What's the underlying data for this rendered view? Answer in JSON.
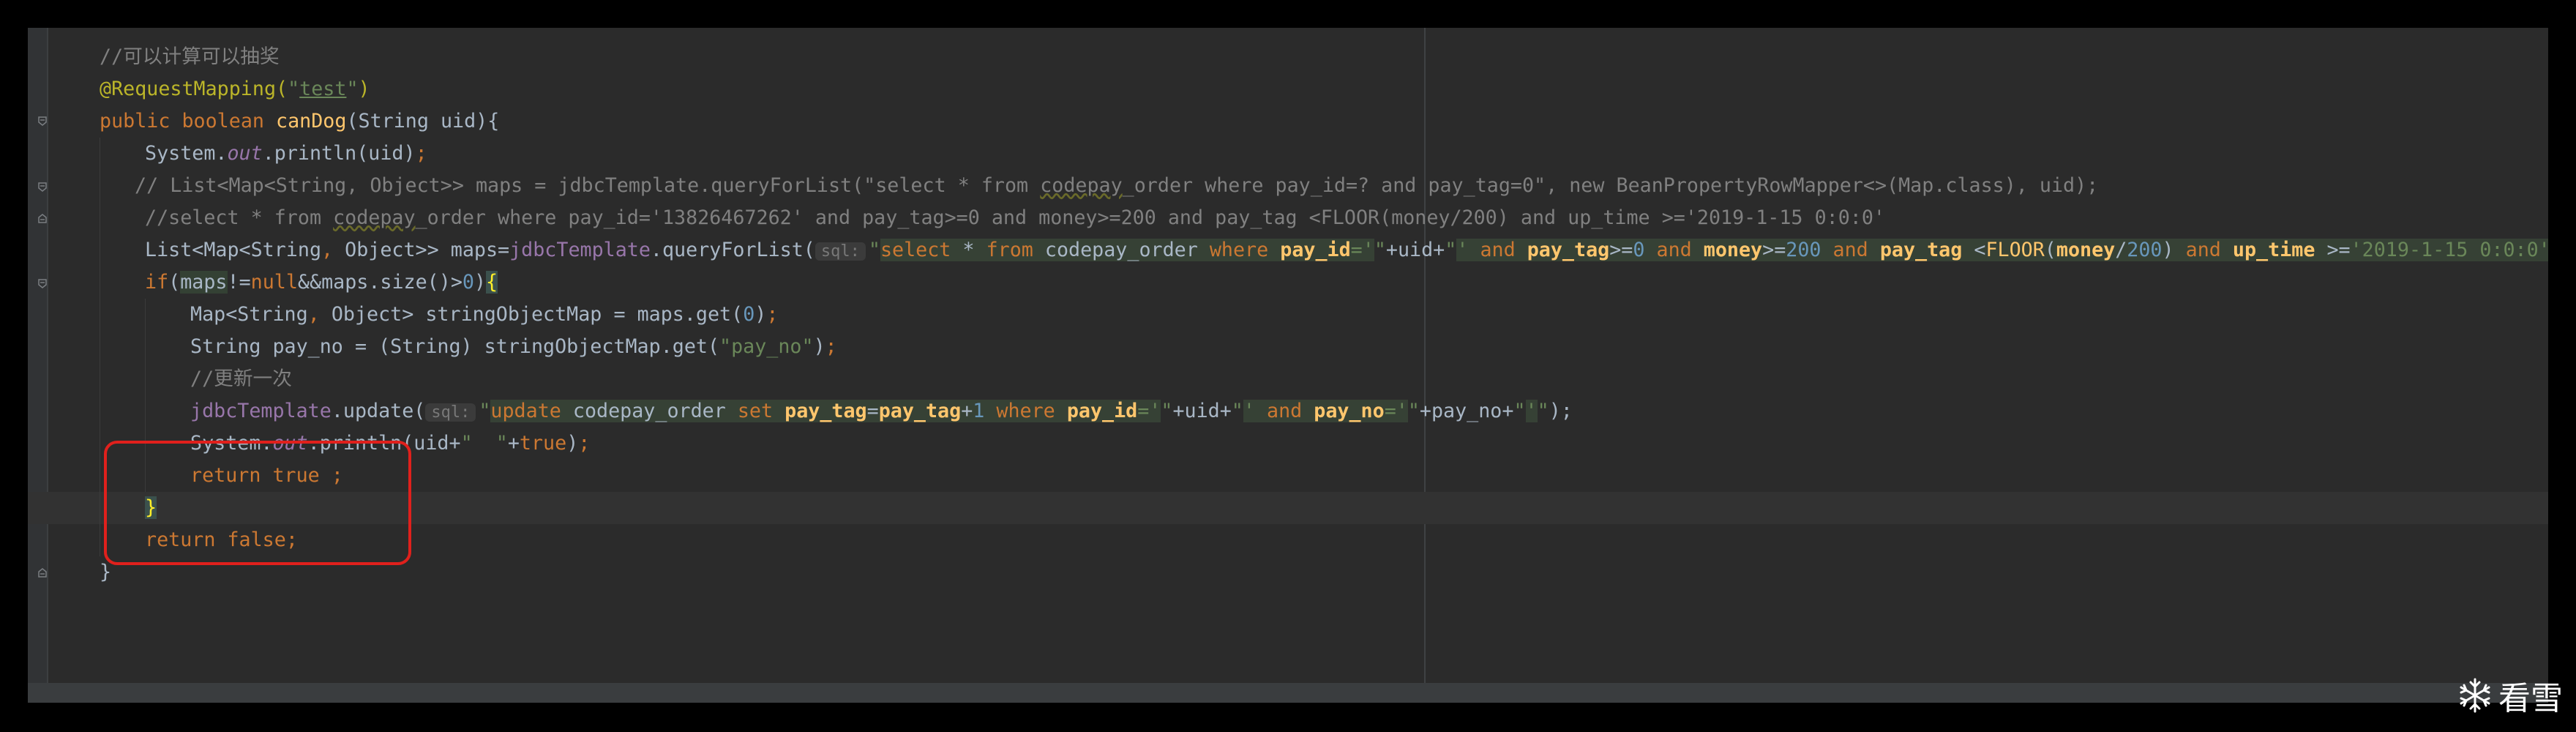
{
  "lines": [
    {
      "segments": [
        {
          "t": "//可以计算可以抽奖",
          "c": "t-comment"
        }
      ]
    },
    {
      "segments": [
        {
          "t": "@RequestMapping(",
          "c": "t-anno"
        },
        {
          "t": "\"",
          "c": "t-str"
        },
        {
          "t": "test",
          "c": "t-str t-underline"
        },
        {
          "t": "\"",
          "c": "t-str"
        },
        {
          "t": ")",
          "c": "t-anno"
        }
      ]
    },
    {
      "segments": [
        {
          "t": "public ",
          "c": "t-kw"
        },
        {
          "t": "boolean ",
          "c": "t-kw"
        },
        {
          "t": "canDog",
          "c": "t-fn"
        },
        {
          "t": "(String uid){",
          "c": "t-default"
        }
      ]
    },
    {
      "segments": [
        {
          "t": "System.",
          "c": "t-default"
        },
        {
          "t": "out",
          "c": "t-static"
        },
        {
          "t": ".println(uid)",
          "c": "t-default"
        },
        {
          "t": ";",
          "c": "t-kw"
        }
      ]
    },
    {
      "segments": [
        {
          "t": "// List<Map<String, Object>> maps = jdbcTemplate.queryForList(\"select * from ",
          "c": "t-comment"
        },
        {
          "t": "codepay",
          "c": "t-comment t-squiggle"
        },
        {
          "t": "_order where pay_id=? and pay_tag=0\", new BeanPropertyRowMapper<>(Map.class), uid);",
          "c": "t-comment"
        }
      ]
    },
    {
      "segments": [
        {
          "t": "//select * from ",
          "c": "t-comment"
        },
        {
          "t": "codepay",
          "c": "t-comment t-squiggle"
        },
        {
          "t": "_order where pay_id='13826467262' and pay_tag>=0 and money>=200 and pay_tag <FLOOR(money/200) and up_time >='2019-1-15 0:0:0'",
          "c": "t-comment"
        }
      ]
    },
    {
      "segments": [
        {
          "t": "List<Map<String",
          "c": "t-default"
        },
        {
          "t": ", ",
          "c": "t-kw"
        },
        {
          "t": "Object>> maps=",
          "c": "t-default"
        },
        {
          "t": "jdbcTemplate",
          "c": "t-field"
        },
        {
          "t": ".queryForList(",
          "c": "t-default"
        },
        {
          "t": "sql:",
          "c": "t-hint"
        },
        {
          "t": "\"",
          "c": "t-str"
        },
        {
          "t": "select ",
          "c": "sql-kw"
        },
        {
          "t": "* ",
          "c": "sql-plain"
        },
        {
          "t": "from ",
          "c": "sql-kw"
        },
        {
          "t": "codepay_order ",
          "c": "sql-plain"
        },
        {
          "t": "where ",
          "c": "sql-kw"
        },
        {
          "t": "pay_id",
          "c": "sql-id"
        },
        {
          "t": "='",
          "c": "sql-str"
        },
        {
          "t": "\"",
          "c": "t-str"
        },
        {
          "t": "+uid+",
          "c": "t-default"
        },
        {
          "t": "\"",
          "c": "t-str"
        },
        {
          "t": "' ",
          "c": "sql-str"
        },
        {
          "t": "and ",
          "c": "sql-kw"
        },
        {
          "t": "pay_tag",
          "c": "sql-id"
        },
        {
          "t": ">=",
          "c": "sql-plain"
        },
        {
          "t": "0 ",
          "c": "sql-num"
        },
        {
          "t": "and ",
          "c": "sql-kw"
        },
        {
          "t": "money",
          "c": "sql-id"
        },
        {
          "t": ">=",
          "c": "sql-plain"
        },
        {
          "t": "200 ",
          "c": "sql-num"
        },
        {
          "t": "and ",
          "c": "sql-kw"
        },
        {
          "t": "pay_tag ",
          "c": "sql-id"
        },
        {
          "t": "<",
          "c": "sql-plain"
        },
        {
          "t": "FLOOR",
          "c": "sql-fn"
        },
        {
          "t": "(",
          "c": "sql-plain"
        },
        {
          "t": "money",
          "c": "sql-id"
        },
        {
          "t": "/",
          "c": "sql-plain"
        },
        {
          "t": "200",
          "c": "sql-num"
        },
        {
          "t": ") ",
          "c": "sql-plain"
        },
        {
          "t": "and ",
          "c": "sql-kw"
        },
        {
          "t": "up_time ",
          "c": "sql-id"
        },
        {
          "t": ">=",
          "c": "sql-plain"
        },
        {
          "t": "'2019-1-15 0:0:0'",
          "c": "sql-str"
        },
        {
          "t": "\"",
          "c": "t-str"
        },
        {
          "t": ");",
          "c": "t-default"
        }
      ]
    },
    {
      "segments": [
        {
          "t": "if",
          "c": "t-kw"
        },
        {
          "t": "(",
          "c": "t-default"
        },
        {
          "t": "maps",
          "c": "t-default t-var-hl"
        },
        {
          "t": "!=",
          "c": "t-default"
        },
        {
          "t": "null",
          "c": "t-kw"
        },
        {
          "t": "&&",
          "c": "t-default"
        },
        {
          "t": "maps",
          "c": "t-default"
        },
        {
          "t": ".size()>",
          "c": "t-default"
        },
        {
          "t": "0",
          "c": "t-num"
        },
        {
          "t": ")",
          "c": "t-default"
        },
        {
          "t": "{",
          "c": "t-brace-hl"
        }
      ]
    },
    {
      "segments": [
        {
          "t": "Map<String",
          "c": "t-default"
        },
        {
          "t": ", ",
          "c": "t-kw"
        },
        {
          "t": "Object> stringObjectMap = maps.get(",
          "c": "t-default"
        },
        {
          "t": "0",
          "c": "t-num"
        },
        {
          "t": ")",
          "c": "t-default"
        },
        {
          "t": ";",
          "c": "t-kw"
        }
      ]
    },
    {
      "segments": [
        {
          "t": "String pay_no = (String) stringObjectMap.get(",
          "c": "t-default"
        },
        {
          "t": "\"pay_no\"",
          "c": "t-str"
        },
        {
          "t": ")",
          "c": "t-default"
        },
        {
          "t": ";",
          "c": "t-kw"
        }
      ]
    },
    {
      "segments": [
        {
          "t": "//更新一次",
          "c": "t-comment"
        }
      ]
    },
    {
      "segments": [
        {
          "t": "jdbcTemplate",
          "c": "t-field"
        },
        {
          "t": ".update(",
          "c": "t-default"
        },
        {
          "t": "sql:",
          "c": "t-hint"
        },
        {
          "t": "\"",
          "c": "t-str"
        },
        {
          "t": "update ",
          "c": "sql-kw"
        },
        {
          "t": "codepay_order ",
          "c": "sql-plain"
        },
        {
          "t": "set ",
          "c": "sql-kw"
        },
        {
          "t": "pay_tag",
          "c": "sql-id"
        },
        {
          "t": "=",
          "c": "sql-plain"
        },
        {
          "t": "pay_tag",
          "c": "sql-id"
        },
        {
          "t": "+",
          "c": "sql-plain"
        },
        {
          "t": "1 ",
          "c": "sql-num"
        },
        {
          "t": "where ",
          "c": "sql-kw"
        },
        {
          "t": "pay_id",
          "c": "sql-id"
        },
        {
          "t": "='",
          "c": "sql-str"
        },
        {
          "t": "\"",
          "c": "t-str"
        },
        {
          "t": "+uid+",
          "c": "t-default"
        },
        {
          "t": "\"",
          "c": "t-str"
        },
        {
          "t": "' ",
          "c": "sql-str"
        },
        {
          "t": "and ",
          "c": "sql-kw"
        },
        {
          "t": "pay_no",
          "c": "sql-id"
        },
        {
          "t": "='",
          "c": "sql-str"
        },
        {
          "t": "\"",
          "c": "t-str"
        },
        {
          "t": "+pay_no+",
          "c": "t-default"
        },
        {
          "t": "\"",
          "c": "t-str"
        },
        {
          "t": "'",
          "c": "sql-str"
        },
        {
          "t": "\"",
          "c": "t-str"
        },
        {
          "t": ");",
          "c": "t-default"
        }
      ]
    },
    {
      "segments": [
        {
          "t": "System.",
          "c": "t-default"
        },
        {
          "t": "out",
          "c": "t-static"
        },
        {
          "t": ".println(uid+",
          "c": "t-default"
        },
        {
          "t": "\"  \"",
          "c": "t-str"
        },
        {
          "t": "+",
          "c": "t-default"
        },
        {
          "t": "true",
          "c": "t-kw"
        },
        {
          "t": ")",
          "c": "t-default"
        },
        {
          "t": ";",
          "c": "t-kw"
        }
      ]
    },
    {
      "segments": [
        {
          "t": "return ",
          "c": "t-kw"
        },
        {
          "t": "true ",
          "c": "t-kw"
        },
        {
          "t": ";",
          "c": "t-kw"
        }
      ]
    },
    {
      "segments": [
        {
          "t": "}",
          "c": "t-brace-hl"
        }
      ]
    },
    {
      "segments": [
        {
          "t": "return ",
          "c": "t-kw"
        },
        {
          "t": "false",
          "c": "t-kw"
        },
        {
          "t": ";",
          "c": "t-kw"
        }
      ]
    },
    {
      "segments": [
        {
          "t": "}",
          "c": "t-default"
        }
      ]
    }
  ],
  "watermark": {
    "text": "看雪",
    "icon": "snowflake-icon"
  },
  "colors": {
    "background": "#2b2b2b",
    "annotation": "#e0201c"
  }
}
